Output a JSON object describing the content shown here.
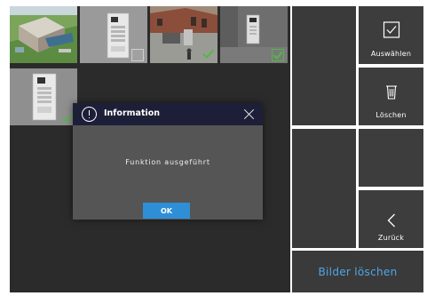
{
  "dialog": {
    "title": "Information",
    "message": "Funktion ausgeführt",
    "ok_label": "OK",
    "icon": "info-circle-icon",
    "close_icon": "close-icon"
  },
  "sidebar": {
    "select": {
      "label": "Auswählen",
      "icon": "checkbox-icon"
    },
    "delete": {
      "label": "Löschen",
      "icon": "trash-icon"
    },
    "back": {
      "label": "Zurück",
      "icon": "chevron-left-icon"
    }
  },
  "footer": {
    "action_label": "Bilder löschen"
  },
  "thumbnails": [
    {
      "subject": "aerial building",
      "selected": false
    },
    {
      "subject": "door intercom panel",
      "selected": false
    },
    {
      "subject": "building entrance",
      "selected": true
    },
    {
      "subject": "intercom on wall",
      "selected": true
    },
    {
      "subject": "intercom panel",
      "selected": true
    }
  ],
  "colors": {
    "accent_blue": "#2e8fd6",
    "footer_text_blue": "#4fa7e6",
    "check_green": "#52b84a",
    "dialog_header": "#1d1f38",
    "dialog_body": "#555555",
    "panel_bg": "#2b2b2b",
    "button_bg": "#3d3d3d"
  }
}
